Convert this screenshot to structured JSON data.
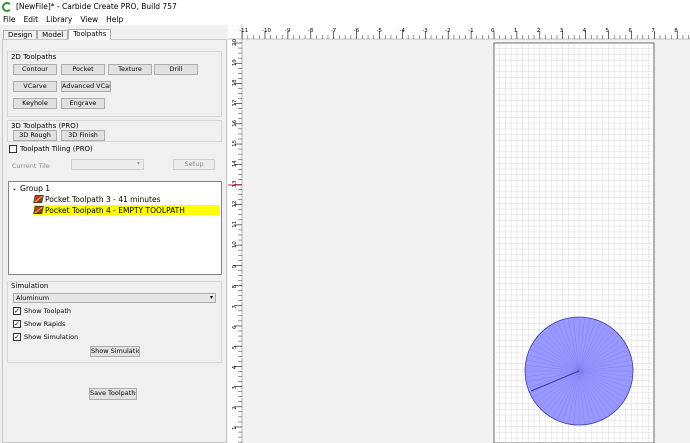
{
  "window": {
    "title": "[NewFile]* - Carbide Create PRO, Build 757"
  },
  "menu": [
    "File",
    "Edit",
    "Library",
    "View",
    "Help"
  ],
  "tabs": [
    {
      "label": "Design",
      "active": false
    },
    {
      "label": "Model",
      "active": false
    },
    {
      "label": "Toolpaths",
      "active": true
    }
  ],
  "toolpaths2d": {
    "label": "2D Toolpaths",
    "buttons": [
      "Contour",
      "Pocket",
      "Texture",
      "Drill",
      "VCarve",
      "Advanced VCarve",
      "Keyhole",
      "Engrave"
    ]
  },
  "toolpaths3d": {
    "label": "3D Toolpaths (PRO)",
    "buttons": [
      "3D Rough",
      "3D Finish"
    ]
  },
  "tiling": {
    "label": "Toolpath Tiling (PRO)",
    "checked": false,
    "current_tile_label": "Current Tile",
    "current_tile_value": "",
    "setup_label": "Setup"
  },
  "toolpath_list": {
    "group_label": "Group 1",
    "items": [
      {
        "label": "Pocket Toolpath 3 - 41 minutes",
        "selected": false
      },
      {
        "label": "Pocket Toolpath 4 - EMPTY TOOLPATH",
        "selected": true
      }
    ]
  },
  "simulation": {
    "label": "Simulation",
    "material": "Aluminum",
    "checks": [
      {
        "label": "Show Toolpath",
        "checked": true
      },
      {
        "label": "Show Rapids",
        "checked": true
      },
      {
        "label": "Show Simulation",
        "checked": true
      }
    ],
    "show_button": "Show Simulation"
  },
  "save_button": "Save Toolpaths",
  "ruler": {
    "x_ticks": [
      "-11",
      "-10",
      "-9",
      "-8",
      "-7",
      "-6",
      "-5",
      "-4",
      "-3",
      "-2",
      "-1",
      "0",
      "1",
      "2",
      "3",
      "4",
      "5",
      "6",
      "7",
      "8"
    ],
    "y_ticks": [
      "20",
      "19",
      "18",
      "17",
      "16",
      "15",
      "14",
      "13",
      "12",
      "11",
      "10",
      "9",
      "8",
      "7",
      "6",
      "5",
      "4",
      "3",
      "2",
      "1"
    ]
  },
  "colors": {
    "selection": "#ffff00",
    "circle_fill": "#9898ff",
    "circle_stroke": "#3a3aa0",
    "grid": "#d0d0d0",
    "ruler_marker": "#e03030"
  }
}
